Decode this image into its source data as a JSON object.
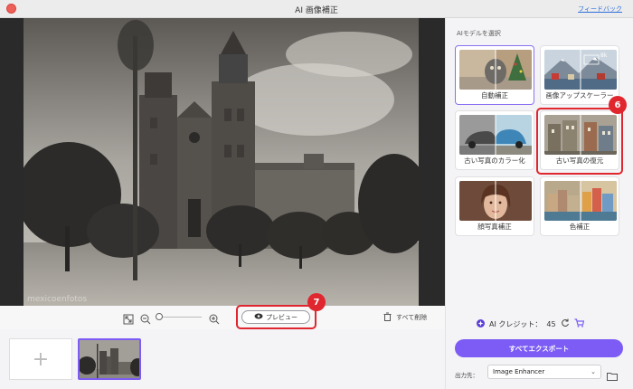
{
  "window": {
    "title": "AI 画像補正",
    "feedback_label": "フィードバック"
  },
  "canvas": {
    "watermark": "mexicoenfotos"
  },
  "toolbar": {
    "preview_label": "プレビュー",
    "clear_all_label": "すべて削除",
    "callout_number": "7"
  },
  "strip": {
    "add_label": "+"
  },
  "sidebar": {
    "section_title": "AIモデルを選択",
    "models": [
      {
        "label": "自動補正",
        "selected": true
      },
      {
        "label": "画像アップスケーラー",
        "badge": "8k"
      },
      {
        "label": "古い写真のカラー化"
      },
      {
        "label": "古い写真の復元"
      },
      {
        "label": "顔写真補正"
      },
      {
        "label": "色補正"
      }
    ],
    "callout_number": "6",
    "credits_label": "AI クレジット：",
    "credits_value": "45",
    "export_label": "すべてエクスポート",
    "output_label": "出力先：",
    "output_value": "Image Enhancer"
  },
  "colors": {
    "accent": "#7c5cf5",
    "highlight": "#e0262e"
  }
}
